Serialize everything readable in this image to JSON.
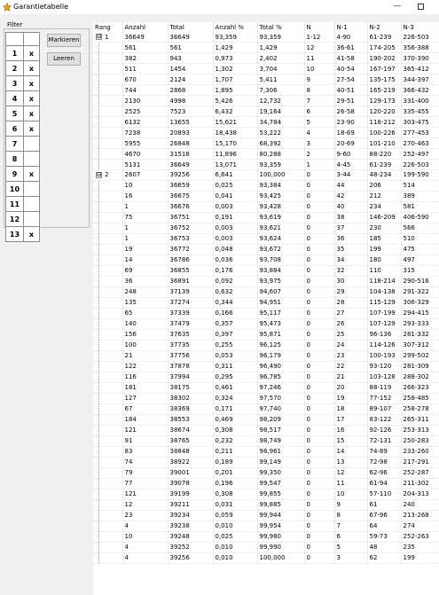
{
  "window": {
    "title": "Garantietabelle"
  },
  "filter": {
    "label": "Filter",
    "mark_button": "Markieren",
    "clear_button": "Leeren",
    "rows": [
      {
        "num": "1",
        "mark": "x"
      },
      {
        "num": "2",
        "mark": "x"
      },
      {
        "num": "3",
        "mark": "x"
      },
      {
        "num": "4",
        "mark": "x"
      },
      {
        "num": "5",
        "mark": "x"
      },
      {
        "num": "6",
        "mark": "x"
      },
      {
        "num": "7",
        "mark": ""
      },
      {
        "num": "8",
        "mark": ""
      },
      {
        "num": "9",
        "mark": "x"
      },
      {
        "num": "10",
        "mark": ""
      },
      {
        "num": "11",
        "mark": ""
      },
      {
        "num": "12",
        "mark": ""
      },
      {
        "num": "13",
        "mark": "x"
      }
    ]
  },
  "table": {
    "columns": [
      "Rang",
      "Anzahl",
      "Total",
      "Anzahl %",
      "Total %",
      "N",
      "N-1",
      "N-2",
      "N-3"
    ],
    "rows": [
      {
        "exp": "⊟",
        "rang": "1",
        "c": [
          "36649",
          "36649",
          "93,359",
          "93,359",
          "1-12",
          "4-90",
          "61-239",
          "226-503"
        ]
      },
      {
        "exp": "",
        "rang": "",
        "c": [
          "561",
          "561",
          "1,429",
          "1,429",
          "12",
          "36-61",
          "174-205",
          "356-388"
        ]
      },
      {
        "exp": "",
        "rang": "",
        "c": [
          "382",
          "943",
          "0,973",
          "2,402",
          "11",
          "41-58",
          "190-202",
          "370-390"
        ]
      },
      {
        "exp": "",
        "rang": "",
        "c": [
          "511",
          "1454",
          "1,302",
          "3,704",
          "10",
          "40-54",
          "167-197",
          "365-412"
        ]
      },
      {
        "exp": "",
        "rang": "",
        "c": [
          "670",
          "2124",
          "1,707",
          "5,411",
          "9",
          "27-54",
          "135-175",
          "344-397"
        ]
      },
      {
        "exp": "",
        "rang": "",
        "c": [
          "744",
          "2868",
          "1,895",
          "7,306",
          "8",
          "40-51",
          "165-219",
          "366-432"
        ]
      },
      {
        "exp": "",
        "rang": "",
        "c": [
          "2130",
          "4998",
          "5,426",
          "12,732",
          "7",
          "29-51",
          "129-173",
          "331-400"
        ]
      },
      {
        "exp": "",
        "rang": "",
        "c": [
          "2525",
          "7523",
          "6,432",
          "19,164",
          "6",
          "26-58",
          "120-220",
          "335-455"
        ]
      },
      {
        "exp": "",
        "rang": "",
        "c": [
          "6132",
          "13655",
          "15,621",
          "34,784",
          "5",
          "23-90",
          "118-212",
          "303-475"
        ]
      },
      {
        "exp": "",
        "rang": "",
        "c": [
          "7238",
          "20893",
          "18,438",
          "53,222",
          "4",
          "18-69",
          "100-226",
          "277-453"
        ]
      },
      {
        "exp": "",
        "rang": "",
        "c": [
          "5955",
          "26848",
          "15,170",
          "68,392",
          "3",
          "20-69",
          "101-210",
          "270-463"
        ]
      },
      {
        "exp": "",
        "rang": "",
        "c": [
          "4670",
          "31518",
          "11,896",
          "80,288",
          "2",
          "9-60",
          "88-220",
          "252-497"
        ]
      },
      {
        "exp": "",
        "rang": "",
        "c": [
          "5131",
          "36649",
          "13,071",
          "93,359",
          "1",
          "4-45",
          "61-239",
          "226-503"
        ]
      },
      {
        "exp": "⊟",
        "rang": "2",
        "c": [
          "2607",
          "39256",
          "6,641",
          "100,000",
          "0",
          "3-44",
          "48-234",
          "199-590"
        ]
      },
      {
        "exp": "",
        "rang": "",
        "c": [
          "10",
          "36659",
          "0,025",
          "93,384",
          "0",
          "44",
          "206",
          "514"
        ]
      },
      {
        "exp": "",
        "rang": "",
        "c": [
          "16",
          "36675",
          "0,041",
          "93,425",
          "0",
          "42",
          "212",
          "389"
        ]
      },
      {
        "exp": "",
        "rang": "",
        "c": [
          "1",
          "36676",
          "0,003",
          "93,428",
          "0",
          "40",
          "234",
          "581"
        ]
      },
      {
        "exp": "",
        "rang": "",
        "c": [
          "75",
          "36751",
          "0,191",
          "93,619",
          "0",
          "38",
          "146-209",
          "406-590"
        ]
      },
      {
        "exp": "",
        "rang": "",
        "c": [
          "1",
          "36752",
          "0,003",
          "93,621",
          "0",
          "37",
          "230",
          "566"
        ]
      },
      {
        "exp": "",
        "rang": "",
        "c": [
          "1",
          "36753",
          "0,003",
          "93,624",
          "0",
          "36",
          "185",
          "510"
        ]
      },
      {
        "exp": "",
        "rang": "",
        "c": [
          "19",
          "36772",
          "0,048",
          "93,672",
          "0",
          "35",
          "199",
          "475"
        ]
      },
      {
        "exp": "",
        "rang": "",
        "c": [
          "14",
          "36786",
          "0,036",
          "93,708",
          "0",
          "34",
          "180",
          "497"
        ]
      },
      {
        "exp": "",
        "rang": "",
        "c": [
          "69",
          "36855",
          "0,176",
          "93,884",
          "0",
          "32",
          "110",
          "315"
        ]
      },
      {
        "exp": "",
        "rang": "",
        "c": [
          "36",
          "36891",
          "0,092",
          "93,975",
          "0",
          "30",
          "118-214",
          "290-516"
        ]
      },
      {
        "exp": "",
        "rang": "",
        "c": [
          "248",
          "37139",
          "0,632",
          "94,607",
          "0",
          "29",
          "104-138",
          "291-322"
        ]
      },
      {
        "exp": "",
        "rang": "",
        "c": [
          "135",
          "37274",
          "0,344",
          "94,951",
          "0",
          "28",
          "115-129",
          "306-329"
        ]
      },
      {
        "exp": "",
        "rang": "",
        "c": [
          "65",
          "37339",
          "0,166",
          "95,117",
          "0",
          "27",
          "107-199",
          "294-415"
        ]
      },
      {
        "exp": "",
        "rang": "",
        "c": [
          "140",
          "37479",
          "0,357",
          "95,473",
          "0",
          "26",
          "107-129",
          "293-333"
        ]
      },
      {
        "exp": "",
        "rang": "",
        "c": [
          "156",
          "37635",
          "0,397",
          "95,871",
          "0",
          "25",
          "96-136",
          "281-332"
        ]
      },
      {
        "exp": "",
        "rang": "",
        "c": [
          "100",
          "37735",
          "0,255",
          "96,125",
          "0",
          "24",
          "114-126",
          "307-312"
        ]
      },
      {
        "exp": "",
        "rang": "",
        "c": [
          "21",
          "37756",
          "0,053",
          "96,179",
          "0",
          "23",
          "100-193",
          "299-502"
        ]
      },
      {
        "exp": "",
        "rang": "",
        "c": [
          "122",
          "37878",
          "0,311",
          "96,490",
          "0",
          "22",
          "93-120",
          "281-309"
        ]
      },
      {
        "exp": "",
        "rang": "",
        "c": [
          "116",
          "37994",
          "0,295",
          "96,785",
          "0",
          "21",
          "103-128",
          "288-302"
        ]
      },
      {
        "exp": "",
        "rang": "",
        "c": [
          "181",
          "38175",
          "0,461",
          "97,246",
          "0",
          "20",
          "88-119",
          "266-323"
        ]
      },
      {
        "exp": "",
        "rang": "",
        "c": [
          "127",
          "38302",
          "0,324",
          "97,570",
          "0",
          "19",
          "77-152",
          "258-485"
        ]
      },
      {
        "exp": "",
        "rang": "",
        "c": [
          "67",
          "38369",
          "0,171",
          "97,740",
          "0",
          "18",
          "89-107",
          "258-278"
        ]
      },
      {
        "exp": "",
        "rang": "",
        "c": [
          "184",
          "38553",
          "0,469",
          "98,209",
          "0",
          "17",
          "83-122",
          "265-311"
        ]
      },
      {
        "exp": "",
        "rang": "",
        "c": [
          "121",
          "38674",
          "0,308",
          "98,517",
          "0",
          "16",
          "92-126",
          "253-313"
        ]
      },
      {
        "exp": "",
        "rang": "",
        "c": [
          "91",
          "38765",
          "0,232",
          "98,749",
          "0",
          "15",
          "72-131",
          "250-283"
        ]
      },
      {
        "exp": "",
        "rang": "",
        "c": [
          "83",
          "38848",
          "0,211",
          "98,961",
          "0",
          "14",
          "74-89",
          "233-260"
        ]
      },
      {
        "exp": "",
        "rang": "",
        "c": [
          "74",
          "38922",
          "0,189",
          "99,149",
          "0",
          "13",
          "72-98",
          "217-291"
        ]
      },
      {
        "exp": "",
        "rang": "",
        "c": [
          "79",
          "39001",
          "0,201",
          "99,350",
          "0",
          "12",
          "62-96",
          "252-287"
        ]
      },
      {
        "exp": "",
        "rang": "",
        "c": [
          "77",
          "39078",
          "0,196",
          "99,547",
          "0",
          "11",
          "61-94",
          "211-302"
        ]
      },
      {
        "exp": "",
        "rang": "",
        "c": [
          "121",
          "39199",
          "0,308",
          "99,855",
          "0",
          "10",
          "57-110",
          "204-313"
        ]
      },
      {
        "exp": "",
        "rang": "",
        "c": [
          "12",
          "39211",
          "0,031",
          "99,885",
          "0",
          "9",
          "61",
          "240"
        ]
      },
      {
        "exp": "",
        "rang": "",
        "c": [
          "23",
          "39234",
          "0,059",
          "99,944",
          "0",
          "8",
          "67-96",
          "213-268"
        ]
      },
      {
        "exp": "",
        "rang": "",
        "c": [
          "4",
          "39238",
          "0,010",
          "99,954",
          "0",
          "7",
          "64",
          "274"
        ]
      },
      {
        "exp": "",
        "rang": "",
        "c": [
          "10",
          "39248",
          "0,025",
          "99,980",
          "0",
          "6",
          "59-73",
          "252-263"
        ]
      },
      {
        "exp": "",
        "rang": "",
        "c": [
          "4",
          "39252",
          "0,010",
          "99,990",
          "0",
          "5",
          "48",
          "235"
        ]
      },
      {
        "exp": "",
        "rang": "",
        "c": [
          "4",
          "39256",
          "0,010",
          "100,000",
          "0",
          "3",
          "62",
          "199"
        ]
      }
    ]
  }
}
